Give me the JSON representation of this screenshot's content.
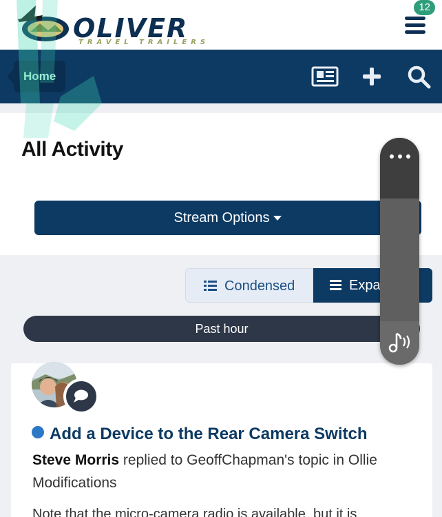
{
  "header": {
    "logo_word": "OLIVER",
    "logo_sub": "TRAVEL TRAILERS",
    "notification_count": "12",
    "menu_icon": "hamburger-icon"
  },
  "nav": {
    "breadcrumb_home": "Home",
    "icons": [
      "newspaper-icon",
      "plus-icon",
      "search-icon"
    ]
  },
  "page": {
    "title": "All Activity",
    "stream_options_label": "Stream Options"
  },
  "view_toggle": {
    "condensed_label": "Condensed",
    "expanded_label": "Expa",
    "selected": "expanded"
  },
  "time_filter": {
    "label": "Past hour"
  },
  "activity": {
    "title": "Add a Device to the Rear Camera Switch",
    "author": "Steve Morris",
    "action_text": " replied to GeoffChapman's topic in Ollie Modifications",
    "snippet": "Note that the micro-camera radio is available, but it is",
    "type_icon": "comment-icon"
  },
  "overlay": {
    "menu_icon": "more-dots-icon",
    "audio_icon": "music-note-icon"
  },
  "colors": {
    "brand_navy": "#0d3a63",
    "accent_mint": "#b9f3df",
    "badge_green": "#2e9e7a",
    "unread_blue": "#2b78c6",
    "pill_dark": "#2e3748"
  }
}
